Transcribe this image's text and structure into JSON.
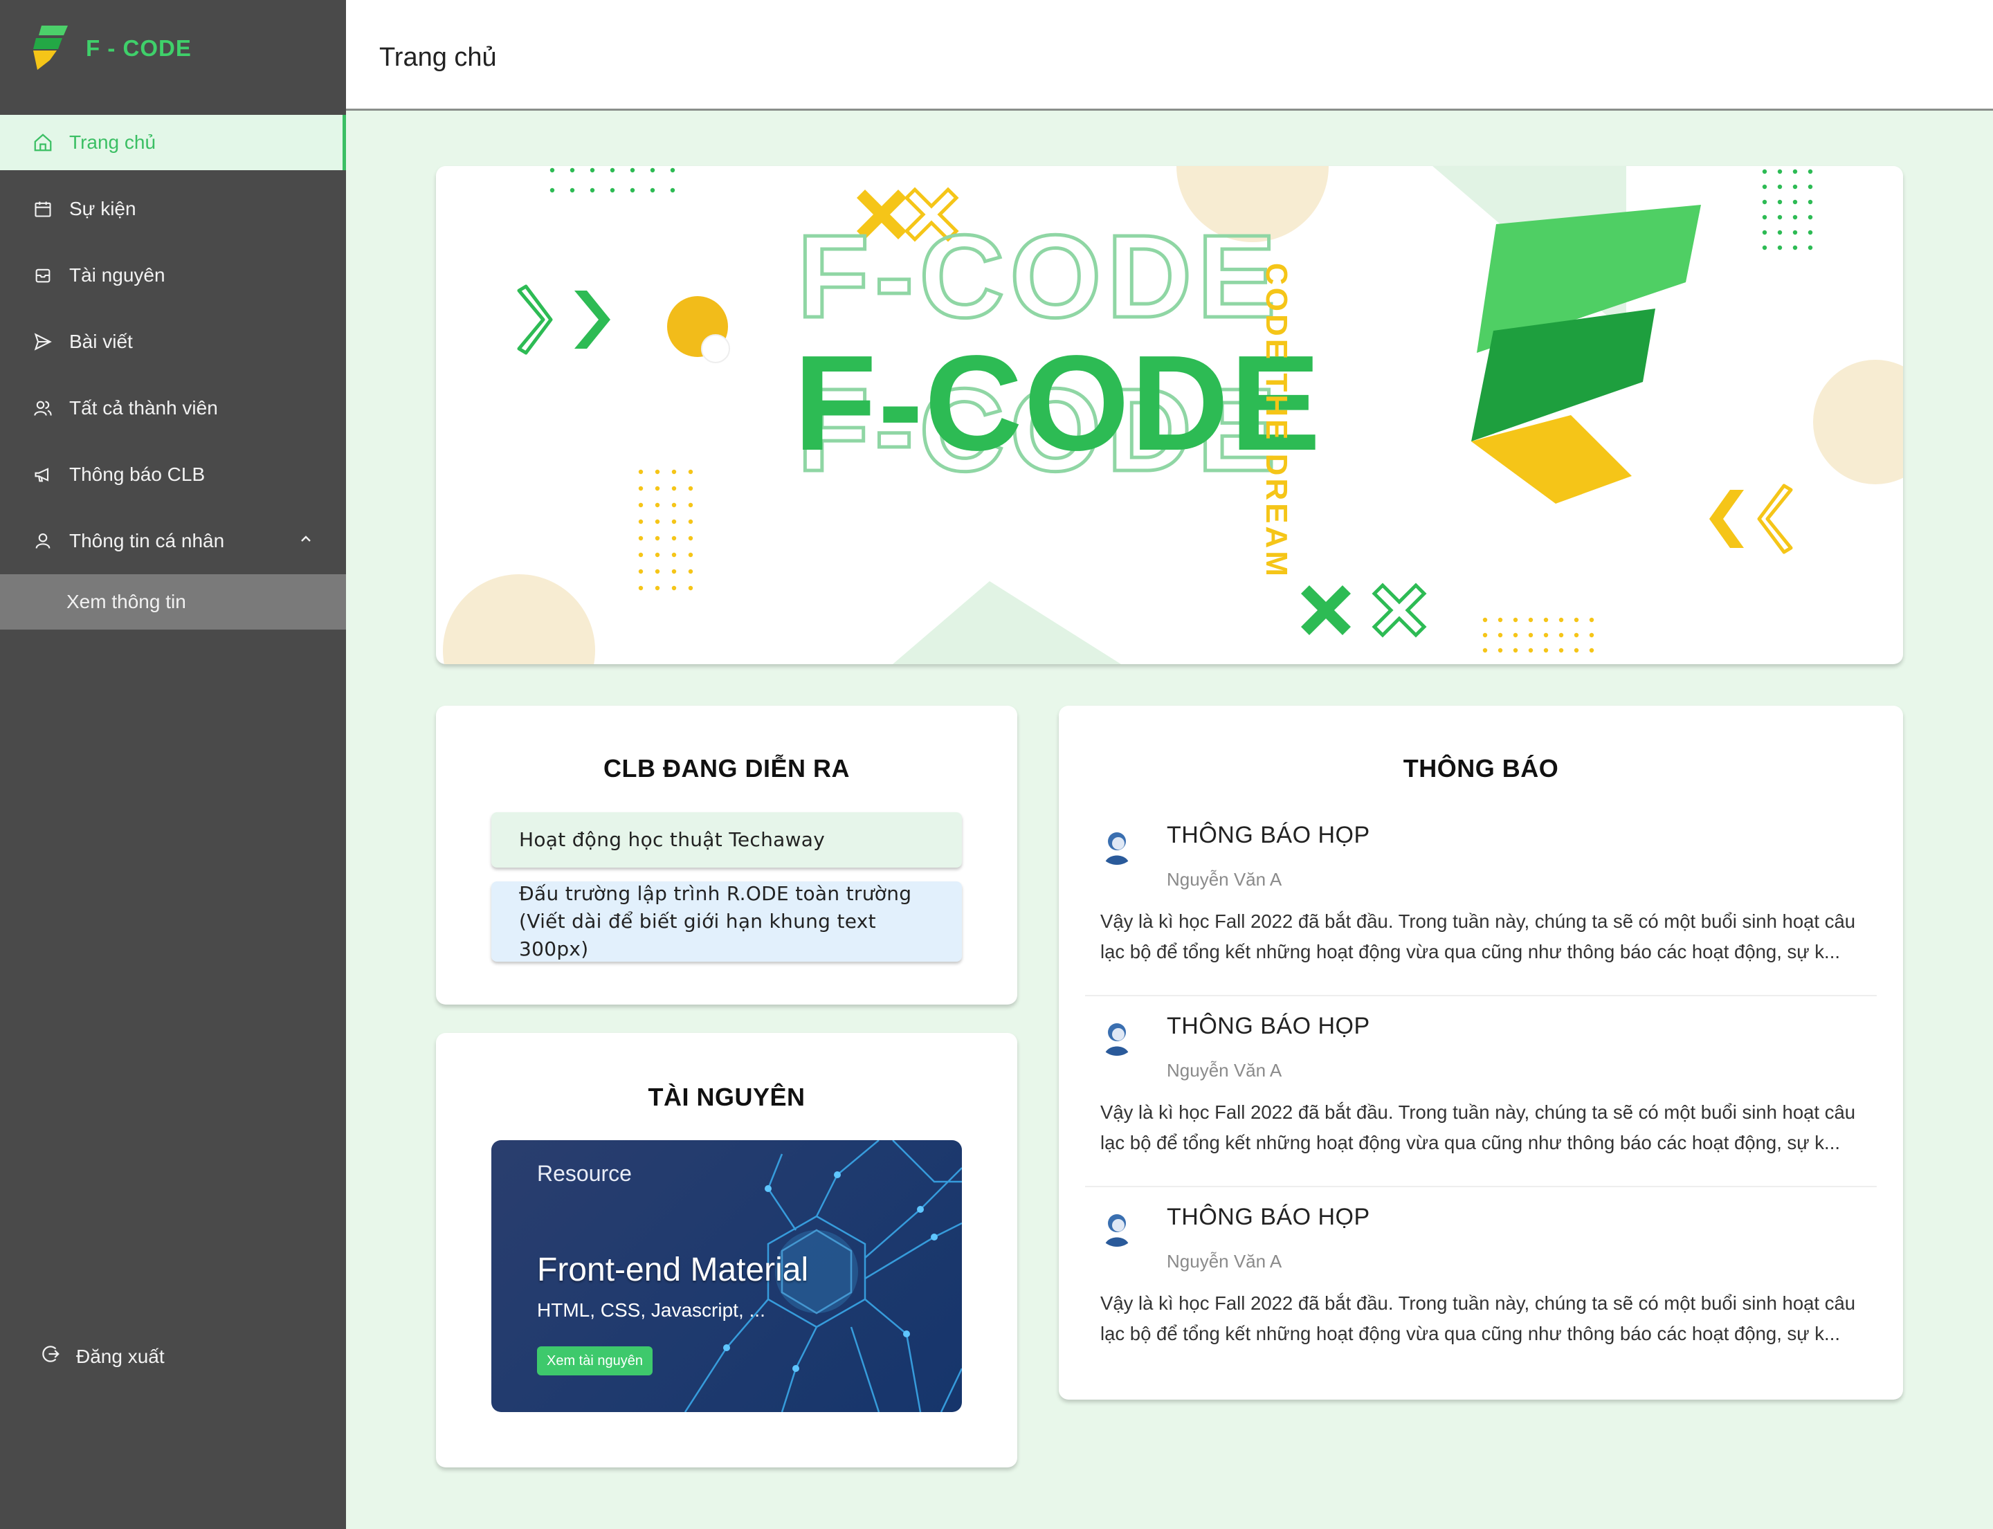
{
  "brand": {
    "name": "F - CODE"
  },
  "header": {
    "title": "Trang chủ"
  },
  "sidebar": {
    "items": [
      {
        "label": "Trang chủ",
        "icon": "home-icon"
      },
      {
        "label": "Sự kiện",
        "icon": "calendar-icon"
      },
      {
        "label": "Tài nguyên",
        "icon": "archive-icon"
      },
      {
        "label": "Bài viết",
        "icon": "send-icon"
      },
      {
        "label": "Tất cả thành viên",
        "icon": "users-icon"
      },
      {
        "label": "Thông báo CLB",
        "icon": "megaphone-icon"
      },
      {
        "label": "Thông tin cá nhân",
        "icon": "user-icon"
      }
    ],
    "subitem": {
      "label": "Xem thông tin"
    },
    "logout": {
      "label": "Đăng xuất",
      "icon": "logout-icon"
    }
  },
  "banner": {
    "main_text": "F-CODE",
    "outline_text": "F-CODE",
    "slogan": "CODE THE DREAM",
    "colors": {
      "green": "#2dbb54",
      "yellow": "#f5c518",
      "light_green": "#8fd6a4"
    }
  },
  "ongoing": {
    "title": "CLB ĐANG DIỄN RA",
    "events": [
      {
        "text": "Hoạt động học thuật Techaway",
        "color": "#e6f5ea"
      },
      {
        "text_line1": "Đấu trường lập trình R.ODE toàn trường",
        "text_line2": "(Viết dài để biết giới hạn khung text 300px)",
        "color": "#e2f0fc"
      }
    ]
  },
  "resources": {
    "title": "TÀI NGUYÊN",
    "card": {
      "label": "Resource",
      "title": "Front-end Material",
      "subtitle": "HTML, CSS, Javascript, ...",
      "button": "Xem tài nguyên"
    }
  },
  "notices": {
    "title": "THÔNG BÁO",
    "items": [
      {
        "title": "THÔNG BÁO HỌP",
        "author": "Nguyễn Văn A",
        "line1": "Vậy là kì học Fall 2022 đã bắt đầu. Trong tuần này, chúng ta sẽ có một buổi sinh hoạt câu",
        "line2": "lạc bộ để tổng kết những hoạt động vừa qua cũng như thông báo các hoạt động, sự k..."
      },
      {
        "title": "THÔNG BÁO HỌP",
        "author": "Nguyễn Văn A",
        "line1": "Vậy là kì học Fall 2022 đã bắt đầu. Trong tuần này, chúng ta sẽ có một buổi sinh hoạt câu",
        "line2": "lạc bộ để tổng kết những hoạt động vừa qua cũng như thông báo các hoạt động, sự k..."
      },
      {
        "title": "THÔNG BÁO HỌP",
        "author": "Nguyễn Văn A",
        "line1": "Vậy là kì học Fall 2022 đã bắt đầu. Trong tuần này, chúng ta sẽ có một buổi sinh hoạt câu",
        "line2": "lạc bộ để tổng kết những hoạt động vừa qua cũng như thông báo các hoạt động, sự k..."
      }
    ]
  }
}
